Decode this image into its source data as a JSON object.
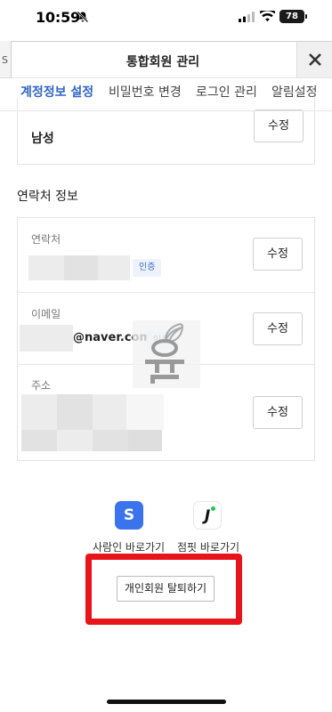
{
  "status_bar": {
    "time": "10:59",
    "battery": "78"
  },
  "header": {
    "title": "통합회원 관리",
    "bg_partial_text": "S"
  },
  "tabs": [
    {
      "label": "계정정보 설정",
      "active": true
    },
    {
      "label": "비밀번호 변경",
      "active": false
    },
    {
      "label": "로그인 관리",
      "active": false
    },
    {
      "label": "알림설정",
      "active": false
    }
  ],
  "gender_section": {
    "value": "남성",
    "edit_label": "수정"
  },
  "contact_section": {
    "title": "연락처 정보",
    "phone": {
      "label": "연락처",
      "badge": "인증",
      "edit_label": "수정"
    },
    "email": {
      "label": "이메일",
      "value": "@naver.com",
      "badge": "인증",
      "edit_label": "수정"
    },
    "address": {
      "label": "주소",
      "edit_label": "수정"
    }
  },
  "shortcuts": [
    {
      "icon_glyph": "S",
      "label": "사람인 바로가기",
      "icon": "saramin-app-icon",
      "color": "#3b73ec"
    },
    {
      "icon_glyph": "J",
      "label": "점핏 바로가기",
      "icon": "jumpit-app-icon",
      "color": "#111111"
    }
  ],
  "withdraw_button": {
    "label": "개인회원 탈퇴하기"
  },
  "colors": {
    "accent": "#2f64c8",
    "highlight_frame": "#e8141b",
    "badge_bg": "#eef3fb"
  }
}
